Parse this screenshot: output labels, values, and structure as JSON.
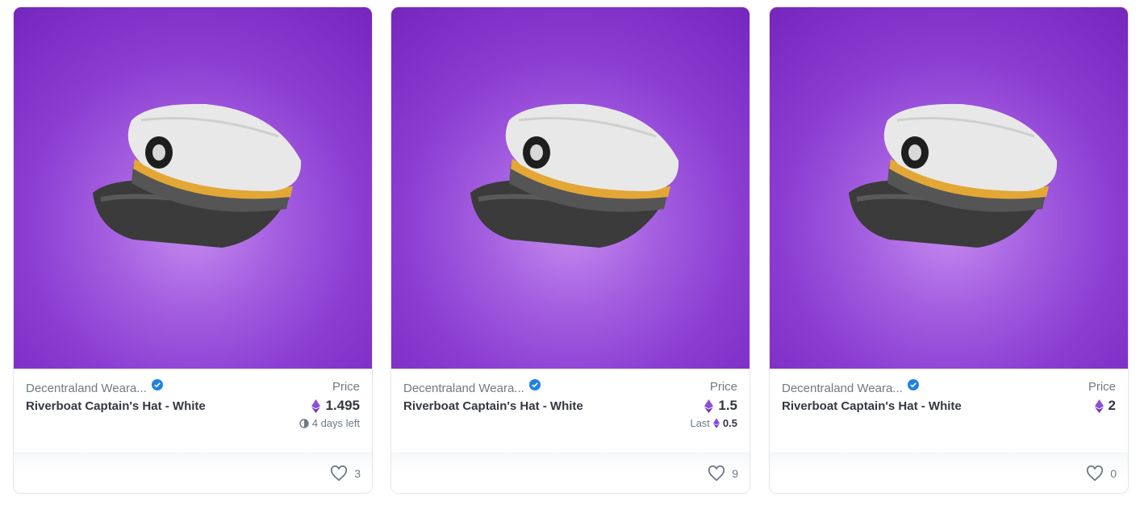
{
  "cards": [
    {
      "collection": "Decentraland Weara...",
      "name": "Riverboat Captain's Hat - White",
      "price_label": "Price",
      "price": "1.495",
      "sub_text": "4 days left",
      "sub_value": "",
      "likes": "3"
    },
    {
      "collection": "Decentraland Weara...",
      "name": "Riverboat Captain's Hat - White",
      "price_label": "Price",
      "price": "1.5",
      "sub_text": "Last",
      "sub_value": "0.5",
      "likes": "9"
    },
    {
      "collection": "Decentraland Weara...",
      "name": "Riverboat Captain's Hat - White",
      "price_label": "Price",
      "price": "2",
      "sub_text": "",
      "sub_value": "",
      "likes": "0"
    }
  ],
  "icons": {
    "verified": "verified-badge-icon",
    "currency": "ethereum-icon",
    "timer": "clock-icon",
    "like": "heart-icon"
  },
  "colors": {
    "media_bg": "#8b3dd2",
    "verified": "#2081e2",
    "eth": "#8a4fd8"
  }
}
